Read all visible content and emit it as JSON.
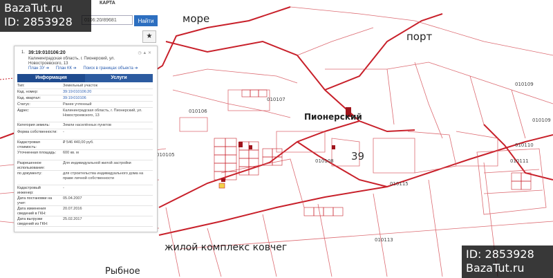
{
  "watermark": {
    "site": "BazaTut.ru",
    "id_label": "ID: 2853928"
  },
  "map_labels": {
    "sea": "море",
    "port": "порт",
    "town": "Пионерский",
    "residential_complex": "жилой комплекс ковчег",
    "village": "Рыбное",
    "zone_number": "39",
    "top_strip": "КАРТА"
  },
  "cadastral_labels": [
    "010109",
    "010106",
    "010107",
    "010108",
    "010105",
    "010115",
    "010110",
    "010111",
    "010113",
    "010109"
  ],
  "search": {
    "value": "0106:20/89681",
    "button_label": "Найти"
  },
  "star_icon": "star-icon",
  "panel": {
    "index": "1.",
    "cadastral_number": "39:19:010106:20",
    "address": "Калининградская область, г. Пионерский, ул. Новостроевского, 13",
    "links": [
      "План ЗУ ➔",
      "План КК ➔",
      "Поиск в границах объекта ➔"
    ],
    "tabs": [
      "Информация",
      "Услуги"
    ],
    "rows": [
      {
        "key": "Тип:",
        "value": "Земельный участок"
      },
      {
        "key": "Кад. номер:",
        "value": "39:19:010106:20"
      },
      {
        "key": "Кад. квартал:",
        "value": "39:19:010106"
      },
      {
        "key": "Статус:",
        "value": "Ранее учтенный"
      },
      {
        "key": "Адрес:",
        "value": "Калининградская область, г. Пионерский, ул. Новостроевского, 13"
      },
      {
        "key": "Категория земель:",
        "value": "Земли населённых пунктов"
      },
      {
        "key": "Форма собственности:",
        "value": "-"
      },
      {
        "key": "Кадастровая стоимость:",
        "value": "₽ 546 440,00 руб."
      },
      {
        "key": "Уточненная площадь:",
        "value": "600 кв. м"
      },
      {
        "key": "Разрешенное использование:",
        "value": "Для индивидуальной жилой застройки"
      },
      {
        "key": "по документу:",
        "value": "для строительства индивидуального дома на праве личной собственности"
      },
      {
        "key": "Кадастровый инженер:",
        "value": "-"
      },
      {
        "key": "Дата постановки на учет:",
        "value": "05.04.2007"
      },
      {
        "key": "Дата изменения сведений в ГКН:",
        "value": "20.07.2016"
      },
      {
        "key": "Дата выгрузки сведений из ГКН:",
        "value": "25.02.2017"
      }
    ]
  },
  "colors": {
    "boundary": "#c8202a",
    "boundary_light": "#e8a0a6",
    "button": "#2d6fc0",
    "tab": "#2c5ba0"
  }
}
